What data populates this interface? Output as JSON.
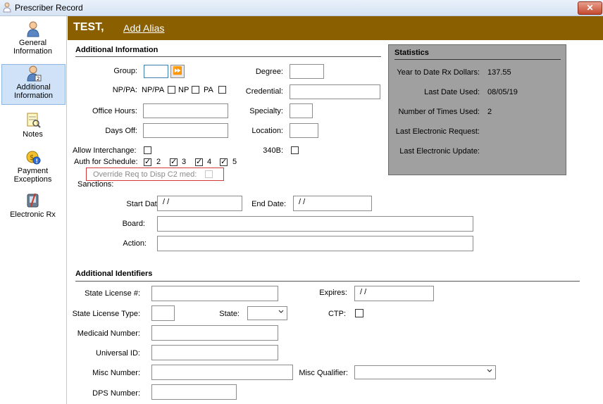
{
  "window": {
    "title": "Prescriber Record",
    "close_label": "✕"
  },
  "sidebar": {
    "items": [
      {
        "label": "General\nInformation",
        "icon": "person-icon"
      },
      {
        "label": "Additional\nInformation",
        "icon": "person-add-icon"
      },
      {
        "label": "Notes",
        "icon": "notes-icon"
      },
      {
        "label": "Payment\nExceptions",
        "icon": "payment-exceptions-icon"
      },
      {
        "label": "Electronic Rx",
        "icon": "electronic-rx-icon"
      }
    ],
    "active_index": 1
  },
  "header": {
    "name": "TEST,",
    "add_alias": "Add Alias"
  },
  "additional_info": {
    "section_title": "Additional Information",
    "group_label": "Group:",
    "npa_label": "NP/PA:",
    "npa_opt1": "NP/PA",
    "npa_opt2": "NP",
    "npa_opt3": "PA",
    "office_hours_label": "Office Hours:",
    "days_off_label": "Days Off:",
    "allow_interchange_label": "Allow Interchange:",
    "auth_schedule_label": "Auth for Schedule:",
    "schedules": [
      "2",
      "3",
      "4",
      "5"
    ],
    "override_label": "Override Req to Disp C2 med:",
    "degree_label": "Degree:",
    "credential_label": "Credential:",
    "specialty_label": "Specialty:",
    "location_label": "Location:",
    "b340_label": "340B:"
  },
  "sanctions": {
    "label": "Sanctions:",
    "start_date_label": "Start Date:",
    "start_date_value": " / /",
    "end_date_label": "End Date:",
    "end_date_value": " / /",
    "board_label": "Board:",
    "action_label": "Action:"
  },
  "statistics": {
    "title": "Statistics",
    "rows": [
      {
        "key": "Year to Date Rx Dollars:",
        "value": "137.55"
      },
      {
        "key": "Last Date Used:",
        "value": "08/05/19"
      },
      {
        "key": "Number of Times Used:",
        "value": "2"
      },
      {
        "key": "Last Electronic Request:",
        "value": ""
      },
      {
        "key": "Last Electronic Update:",
        "value": ""
      }
    ]
  },
  "identifiers": {
    "section_title": "Additional Identifiers",
    "state_license_label": "State License #:",
    "expires_label": "Expires:",
    "expires_value": " / /",
    "state_license_type_label": "State License Type:",
    "state_label": "State:",
    "ctp_label": "CTP:",
    "medicaid_label": "Medicaid Number:",
    "universal_label": "Universal ID:",
    "misc_number_label": "Misc Number:",
    "misc_qualifier_label": "Misc Qualifier:",
    "dps_label": "DPS Number:"
  },
  "colors": {
    "header": "#8a5f00",
    "stats_bg": "#a0a0a0",
    "override_border": "#d23a3a"
  }
}
